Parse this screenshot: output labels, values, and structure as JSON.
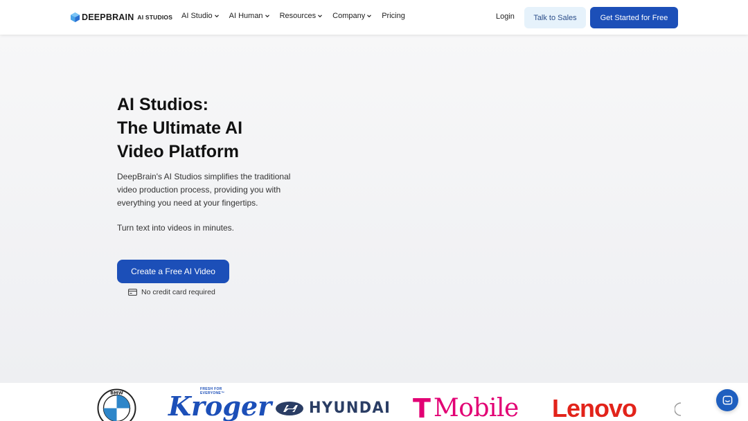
{
  "navbar": {
    "logo": {
      "brand": "DEEPBRAIN",
      "sub": "AI STUDIOS"
    },
    "links": [
      {
        "label": "AI Studio",
        "dropdown": true
      },
      {
        "label": "AI Human",
        "dropdown": true
      },
      {
        "label": "Resources",
        "dropdown": true
      },
      {
        "label": "Company",
        "dropdown": true
      },
      {
        "label": "Pricing",
        "dropdown": false
      }
    ],
    "login": "Login",
    "talk_to_sales": "Talk to Sales",
    "get_started": "Get Started for Free"
  },
  "hero": {
    "title_lines": [
      "AI Studios:",
      "The Ultimate AI",
      "Video Platform"
    ],
    "description": "DeepBrain's AI Studios simplifies the traditional video production process, providing you with everything you need at your fingertips.",
    "tagline": "Turn text into videos in minutes.",
    "cta": "Create a Free AI Video",
    "no_card": "No credit card required"
  },
  "logos": {
    "bmw": "BMW",
    "kroger": {
      "tag": "FRESH FOR EVERYONE™",
      "word": "Kroger"
    },
    "hyundai": "HYUNDAI",
    "tmobile": {
      "t": "T",
      "word": "Mobile"
    },
    "lenovo": "Lenovo"
  },
  "colors": {
    "primary": "#1c4fb8",
    "secondary_bg": "#e6f2fb",
    "hero_bg": "#f2f3f5",
    "tmobile": "#e20074",
    "lenovo": "#e2231a",
    "kroger": "#1c4fb8"
  },
  "icons": {
    "logo": "deepbrain-cube-icon",
    "chevron": "chevron-down-icon",
    "card": "credit-card-icon",
    "chat": "chat-icon"
  }
}
